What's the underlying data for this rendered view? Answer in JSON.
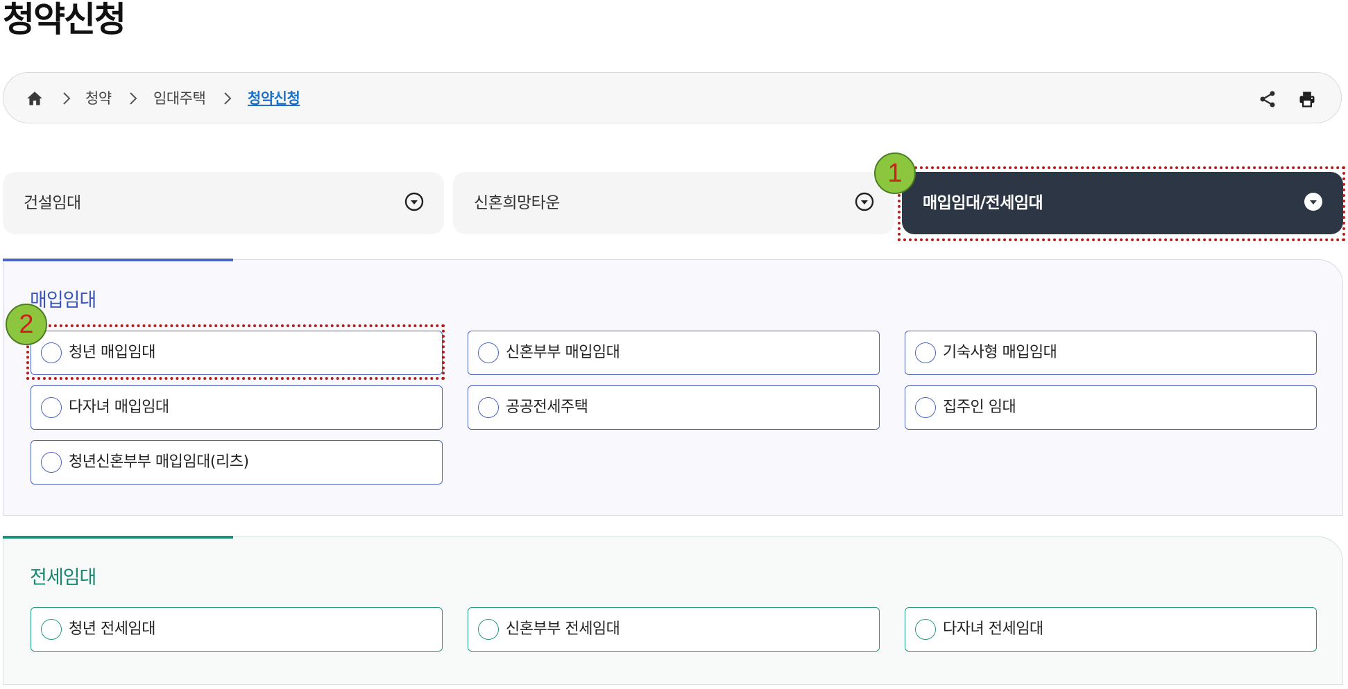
{
  "page": {
    "title": "청약신청"
  },
  "breadcrumb": {
    "items": [
      "청약",
      "임대주택",
      "청약신청"
    ]
  },
  "tabs": [
    {
      "label": "건설임대",
      "active": false
    },
    {
      "label": "신혼희망타운",
      "active": false
    },
    {
      "label": "매입임대/전세임대",
      "active": true
    }
  ],
  "sections": [
    {
      "title": "매입임대",
      "options": [
        "청년 매입임대",
        "신혼부부 매입임대",
        "기숙사형 매입임대",
        "다자녀 매입임대",
        "공공전세주택",
        "집주인 임대",
        "청년신혼부부 매입임대(리츠)"
      ]
    },
    {
      "title": "전세임대",
      "options": [
        "청년 전세임대",
        "신혼부부 전세임대",
        "다자녀 전세임대"
      ]
    }
  ],
  "annotations": {
    "badge1": "1",
    "badge2": "2"
  },
  "colors": {
    "active_tab": "#2c3645",
    "purchase_accent": "#4a63c7",
    "jeonse_accent": "#1b8f78",
    "highlight": "#b41c1c",
    "badge_fill": "#8cc63f",
    "badge_text": "#d21e1e"
  }
}
